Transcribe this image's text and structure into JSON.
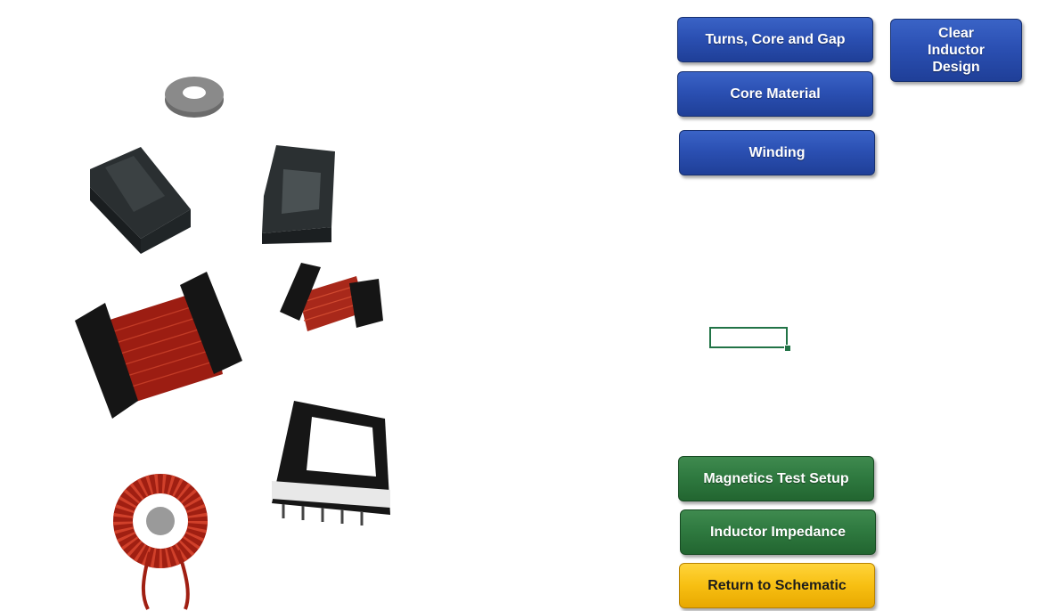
{
  "buttons": {
    "turns_core_gap": "Turns, Core and Gap",
    "clear_inductor_design": "Clear Inductor Design",
    "core_material": "Core Material",
    "winding": "Winding",
    "magnetics_test_setup": "Magnetics Test Setup",
    "inductor_impedance": "Inductor Impedance",
    "return_to_schematic": "Return to Schematic"
  },
  "selected_cell": {
    "value": ""
  },
  "colors": {
    "blue_button": "#2b50b3",
    "green_button": "#2f7a40",
    "yellow_button": "#f7bf12",
    "cell_selection": "#217346"
  }
}
